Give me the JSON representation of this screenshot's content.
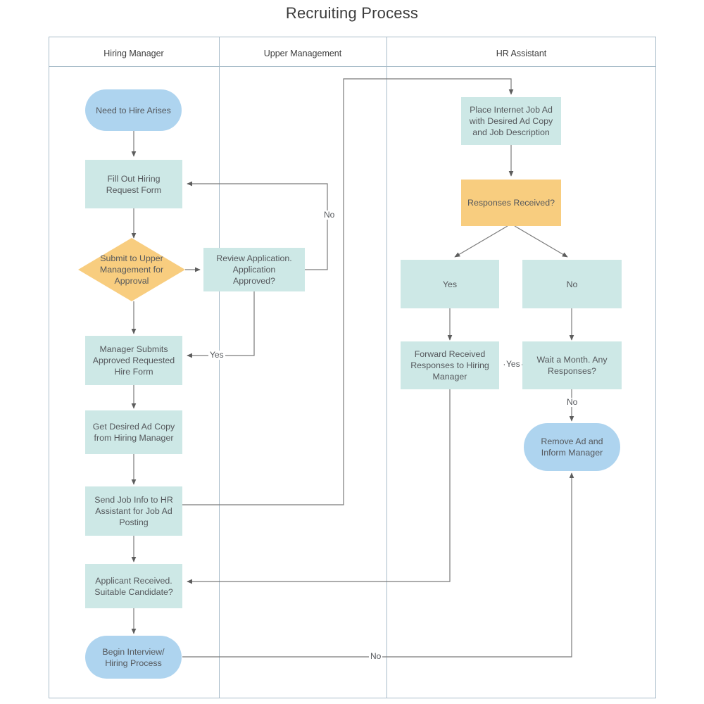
{
  "title": "Recruiting Process",
  "lanes": [
    {
      "id": "hiring-manager",
      "label": "Hiring Manager"
    },
    {
      "id": "upper-management",
      "label": "Upper Management"
    },
    {
      "id": "hr-assistant",
      "label": "HR Assistant"
    }
  ],
  "colors": {
    "terminator": "#aed4ef",
    "process": "#cde8e6",
    "decision": "#f8cd7f",
    "frame": "#a8bcc9",
    "connector": "#6e6e6e",
    "text": "#55585c"
  },
  "nodes": [
    {
      "id": "need-to-hire-arises",
      "lane": "hiring-manager",
      "shape": "terminator",
      "label": "Need to Hire Arises"
    },
    {
      "id": "fill-out-hiring-request-form",
      "lane": "hiring-manager",
      "shape": "process",
      "label": "Fill Out Hiring\nRequest Form"
    },
    {
      "id": "submit-to-upper-management-for-approval",
      "lane": "hiring-manager",
      "shape": "decision",
      "label": "Submit to Upper\nManagement for\nApproval"
    },
    {
      "id": "manager-submits-approved-requested-hire-form",
      "lane": "hiring-manager",
      "shape": "process",
      "label": "Manager Submits\nApproved Requested\nHire Form"
    },
    {
      "id": "get-desired-ad-copy-from-hiring-manager",
      "lane": "hiring-manager",
      "shape": "process",
      "label": "Get Desired Ad Copy\nfrom Hiring Manager"
    },
    {
      "id": "send-job-info-to-hr-assistant-for-job-ad-posting",
      "lane": "hiring-manager",
      "shape": "process",
      "label": "Send Job Info to HR\nAssistant for Job Ad\nPosting"
    },
    {
      "id": "applicant-received-suitable-candidate",
      "lane": "hiring-manager",
      "shape": "process",
      "label": "Applicant Received.\nSuitable Candidate?"
    },
    {
      "id": "begin-interview-hiring-process",
      "lane": "hiring-manager",
      "shape": "terminator",
      "label": "Begin Interview/\nHiring Process"
    },
    {
      "id": "review-application-application-approved",
      "lane": "upper-management",
      "shape": "process",
      "label": "Review Application.\nApplication\nApproved?"
    },
    {
      "id": "place-internet-job-ad",
      "lane": "hr-assistant",
      "shape": "process",
      "label": "Place Internet Job Ad\nwith Desired Ad Copy\nand Job Description"
    },
    {
      "id": "responses-received",
      "lane": "hr-assistant",
      "shape": "decision",
      "label": "Responses Received?"
    },
    {
      "id": "responses-yes",
      "lane": "hr-assistant",
      "shape": "process",
      "label": "Yes"
    },
    {
      "id": "responses-no",
      "lane": "hr-assistant",
      "shape": "process",
      "label": "No"
    },
    {
      "id": "forward-received-responses-to-hiring-manager",
      "lane": "hr-assistant",
      "shape": "process",
      "label": "Forward Received\nResponses to Hiring\nManager"
    },
    {
      "id": "wait-a-month-any-responses",
      "lane": "hr-assistant",
      "shape": "process",
      "label": "Wait a Month. Any\nResponses?"
    },
    {
      "id": "remove-ad-and-inform-manager",
      "lane": "hr-assistant",
      "shape": "terminator",
      "label": "Remove Ad and\nInform Manager"
    }
  ],
  "edge_labels": {
    "review_no": "No",
    "review_yes": "Yes",
    "wait_yes": "Yes",
    "wait_no": "No",
    "candidate_no": "No"
  }
}
